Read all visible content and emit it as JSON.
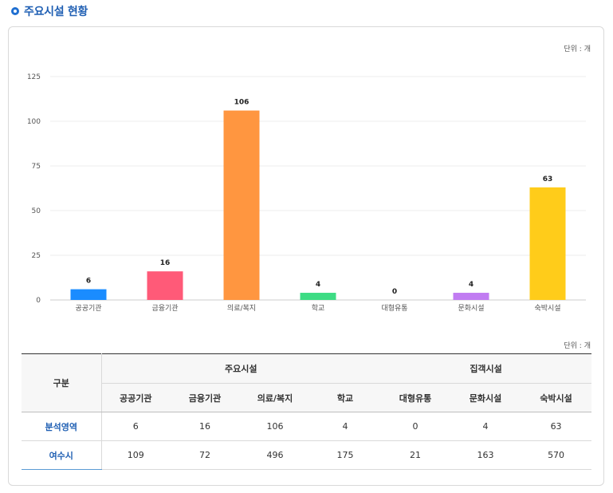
{
  "section": {
    "title": "주요시설 현황"
  },
  "chart_unit": "단위 : 개",
  "table_unit": "단위 : 개",
  "chart_data": {
    "type": "bar",
    "title": "",
    "xlabel": "",
    "ylabel": "",
    "categories": [
      "공공기관",
      "금융기관",
      "의료/복지",
      "학교",
      "대형유통",
      "문화시설",
      "숙박시설"
    ],
    "values": [
      6,
      16,
      106,
      4,
      0,
      4,
      63
    ],
    "colors": [
      "#1a8cff",
      "#ff5a78",
      "#ff9640",
      "#3ddc84",
      "#a9c7ee",
      "#c17cf2",
      "#ffcc1a"
    ],
    "ylim": [
      0,
      125
    ],
    "yticks": [
      0,
      25,
      50,
      75,
      100,
      125
    ],
    "grid": true,
    "legend": "none"
  },
  "table": {
    "corner": "구분",
    "group1": "주요시설",
    "group2": "집객시설",
    "columns": [
      "공공기관",
      "금융기관",
      "의료/복지",
      "학교",
      "대형유통",
      "문화시설",
      "숙박시설"
    ],
    "rows": [
      {
        "label": "분석영역",
        "values": [
          "6",
          "16",
          "106",
          "4",
          "0",
          "4",
          "63"
        ]
      },
      {
        "label": "여수시",
        "values": [
          "109",
          "72",
          "496",
          "175",
          "21",
          "163",
          "570"
        ]
      }
    ]
  }
}
